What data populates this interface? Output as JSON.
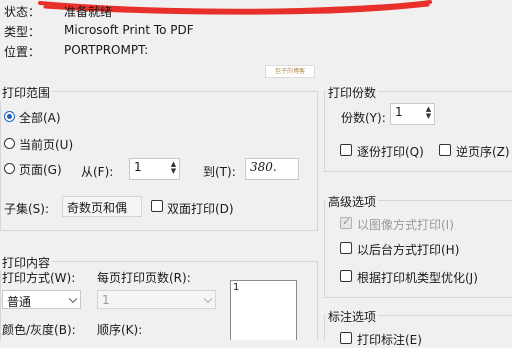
{
  "printer": {
    "status_label": "状态：",
    "status_value": "准备就绪",
    "type_label": "类型：",
    "type_value": "Microsoft Print To PDF",
    "location_label": "位置：",
    "location_value": "PORTPROMPT:"
  },
  "stamp": "包子的博客",
  "range": {
    "title": "打印范围",
    "all": "全部(A)",
    "current": "当前页(U)",
    "pages": "页面(G)",
    "from_label": "从(F):",
    "from_value": "1",
    "to_label": "到(T):",
    "to_value": "380.",
    "subset_label": "子集(S):",
    "subset_value": "奇数页和偶",
    "duplex": "双面打印(D)"
  },
  "copies": {
    "title": "打印份数",
    "label": "份数(Y):",
    "value": "1",
    "collate": "逐份打印(Q)",
    "reverse": "逆页序(Z)"
  },
  "advanced": {
    "title": "高级选项",
    "as_image": "以图像方式打印(I)",
    "background": "以后台方式打印(H)",
    "optimize": "根据打印机类型优化(J)"
  },
  "content": {
    "title": "打印内容",
    "mode_label": "打印方式(W):",
    "mode_value": "普通",
    "pages_per_sheet_label": "每页打印页数(R):",
    "pages_per_sheet_value": "1",
    "color_label": "颜色/灰度(B):",
    "order_label": "顺序(K):",
    "preview_number": "1"
  },
  "annotation": {
    "title": "标注选项",
    "print_annotations": "打印标注(E)"
  },
  "colors": {
    "accent": "#1d63b8",
    "scribble": "#e8302b"
  }
}
